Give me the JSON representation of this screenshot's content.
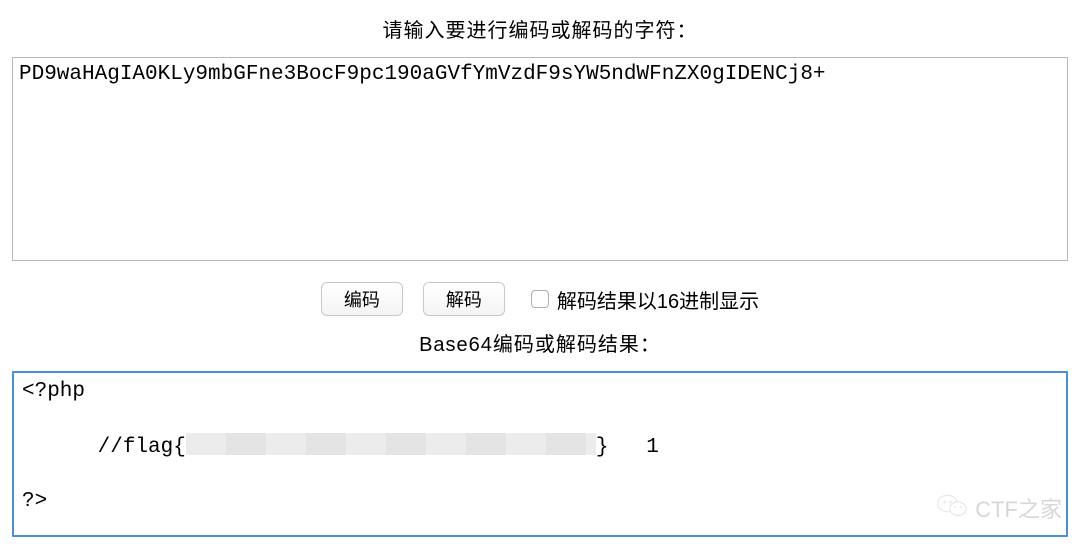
{
  "heading_input": "请输入要进行编码或解码的字符：",
  "heading_output": "Base64编码或解码结果：",
  "input_value": "PD9waHAgIA0KLy9mbGFne3BocF9pc190aGVfYmVzdF9sYW5ndWFnZX0gIDENCj8+",
  "buttons": {
    "encode": "编码",
    "decode": "解码"
  },
  "checkbox": {
    "label": "解码结果以16进制显示"
  },
  "output": {
    "line1": "<?php",
    "line2_prefix": "//flag{",
    "line2_suffix": "}   1",
    "line3": "?>"
  },
  "watermark": {
    "text": "CTF之家"
  }
}
